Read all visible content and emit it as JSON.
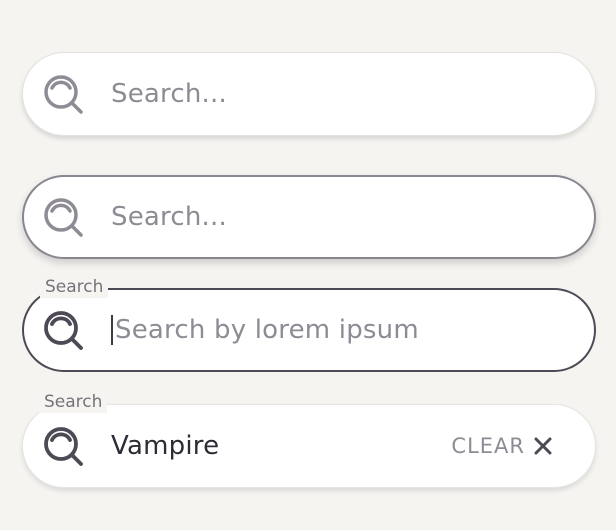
{
  "fields": [
    {
      "placeholder": "Search...",
      "state": "default"
    },
    {
      "placeholder": "Search...",
      "state": "hover"
    },
    {
      "label": "Search",
      "placeholder": "Search by lorem ipsum",
      "state": "focused"
    },
    {
      "label": "Search",
      "value": "Vampire",
      "clear_label": "CLEAR",
      "state": "filled"
    }
  ],
  "icons": {
    "search": "search-icon",
    "clear": "close-icon"
  },
  "colors": {
    "background": "#f5f4f1",
    "field": "#ffffff",
    "icon_default": "#8f8b94",
    "icon_active": "#4d4a55",
    "text": "#2e2b35",
    "placeholder": "#8f8b94"
  }
}
